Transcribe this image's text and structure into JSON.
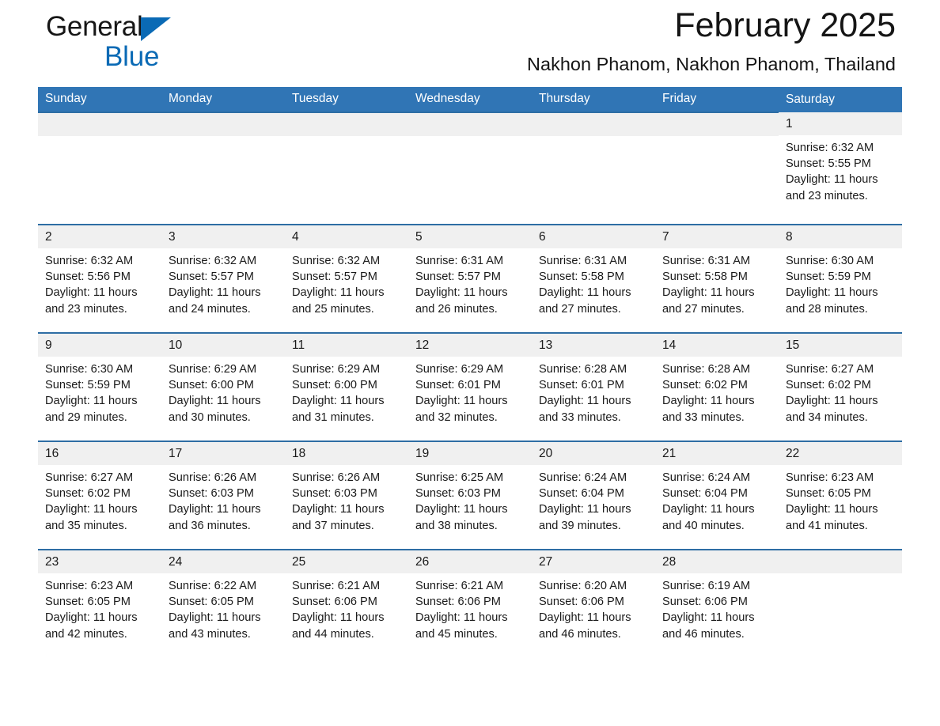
{
  "brand": {
    "name_part1": "General",
    "name_part2": "Blue",
    "triangle_icon": "triangle-icon",
    "accent_color": "#0a6ab5"
  },
  "header": {
    "title": "February 2025",
    "subtitle": "Nakhon Phanom, Nakhon Phanom, Thailand"
  },
  "theme": {
    "header_blue": "#3075b5",
    "row_border_blue": "#2e6da4",
    "daynum_bg": "#f0f0f0"
  },
  "calendar": {
    "weekday_headers": [
      "Sunday",
      "Monday",
      "Tuesday",
      "Wednesday",
      "Thursday",
      "Friday",
      "Saturday"
    ],
    "weeks": [
      [
        {
          "day": "",
          "lines": []
        },
        {
          "day": "",
          "lines": []
        },
        {
          "day": "",
          "lines": []
        },
        {
          "day": "",
          "lines": []
        },
        {
          "day": "",
          "lines": []
        },
        {
          "day": "",
          "lines": []
        },
        {
          "day": "1",
          "lines": [
            "Sunrise: 6:32 AM",
            "Sunset: 5:55 PM",
            "Daylight: 11 hours",
            "and 23 minutes."
          ]
        }
      ],
      [
        {
          "day": "2",
          "lines": [
            "Sunrise: 6:32 AM",
            "Sunset: 5:56 PM",
            "Daylight: 11 hours",
            "and 23 minutes."
          ]
        },
        {
          "day": "3",
          "lines": [
            "Sunrise: 6:32 AM",
            "Sunset: 5:57 PM",
            "Daylight: 11 hours",
            "and 24 minutes."
          ]
        },
        {
          "day": "4",
          "lines": [
            "Sunrise: 6:32 AM",
            "Sunset: 5:57 PM",
            "Daylight: 11 hours",
            "and 25 minutes."
          ]
        },
        {
          "day": "5",
          "lines": [
            "Sunrise: 6:31 AM",
            "Sunset: 5:57 PM",
            "Daylight: 11 hours",
            "and 26 minutes."
          ]
        },
        {
          "day": "6",
          "lines": [
            "Sunrise: 6:31 AM",
            "Sunset: 5:58 PM",
            "Daylight: 11 hours",
            "and 27 minutes."
          ]
        },
        {
          "day": "7",
          "lines": [
            "Sunrise: 6:31 AM",
            "Sunset: 5:58 PM",
            "Daylight: 11 hours",
            "and 27 minutes."
          ]
        },
        {
          "day": "8",
          "lines": [
            "Sunrise: 6:30 AM",
            "Sunset: 5:59 PM",
            "Daylight: 11 hours",
            "and 28 minutes."
          ]
        }
      ],
      [
        {
          "day": "9",
          "lines": [
            "Sunrise: 6:30 AM",
            "Sunset: 5:59 PM",
            "Daylight: 11 hours",
            "and 29 minutes."
          ]
        },
        {
          "day": "10",
          "lines": [
            "Sunrise: 6:29 AM",
            "Sunset: 6:00 PM",
            "Daylight: 11 hours",
            "and 30 minutes."
          ]
        },
        {
          "day": "11",
          "lines": [
            "Sunrise: 6:29 AM",
            "Sunset: 6:00 PM",
            "Daylight: 11 hours",
            "and 31 minutes."
          ]
        },
        {
          "day": "12",
          "lines": [
            "Sunrise: 6:29 AM",
            "Sunset: 6:01 PM",
            "Daylight: 11 hours",
            "and 32 minutes."
          ]
        },
        {
          "day": "13",
          "lines": [
            "Sunrise: 6:28 AM",
            "Sunset: 6:01 PM",
            "Daylight: 11 hours",
            "and 33 minutes."
          ]
        },
        {
          "day": "14",
          "lines": [
            "Sunrise: 6:28 AM",
            "Sunset: 6:02 PM",
            "Daylight: 11 hours",
            "and 33 minutes."
          ]
        },
        {
          "day": "15",
          "lines": [
            "Sunrise: 6:27 AM",
            "Sunset: 6:02 PM",
            "Daylight: 11 hours",
            "and 34 minutes."
          ]
        }
      ],
      [
        {
          "day": "16",
          "lines": [
            "Sunrise: 6:27 AM",
            "Sunset: 6:02 PM",
            "Daylight: 11 hours",
            "and 35 minutes."
          ]
        },
        {
          "day": "17",
          "lines": [
            "Sunrise: 6:26 AM",
            "Sunset: 6:03 PM",
            "Daylight: 11 hours",
            "and 36 minutes."
          ]
        },
        {
          "day": "18",
          "lines": [
            "Sunrise: 6:26 AM",
            "Sunset: 6:03 PM",
            "Daylight: 11 hours",
            "and 37 minutes."
          ]
        },
        {
          "day": "19",
          "lines": [
            "Sunrise: 6:25 AM",
            "Sunset: 6:03 PM",
            "Daylight: 11 hours",
            "and 38 minutes."
          ]
        },
        {
          "day": "20",
          "lines": [
            "Sunrise: 6:24 AM",
            "Sunset: 6:04 PM",
            "Daylight: 11 hours",
            "and 39 minutes."
          ]
        },
        {
          "day": "21",
          "lines": [
            "Sunrise: 6:24 AM",
            "Sunset: 6:04 PM",
            "Daylight: 11 hours",
            "and 40 minutes."
          ]
        },
        {
          "day": "22",
          "lines": [
            "Sunrise: 6:23 AM",
            "Sunset: 6:05 PM",
            "Daylight: 11 hours",
            "and 41 minutes."
          ]
        }
      ],
      [
        {
          "day": "23",
          "lines": [
            "Sunrise: 6:23 AM",
            "Sunset: 6:05 PM",
            "Daylight: 11 hours",
            "and 42 minutes."
          ]
        },
        {
          "day": "24",
          "lines": [
            "Sunrise: 6:22 AM",
            "Sunset: 6:05 PM",
            "Daylight: 11 hours",
            "and 43 minutes."
          ]
        },
        {
          "day": "25",
          "lines": [
            "Sunrise: 6:21 AM",
            "Sunset: 6:06 PM",
            "Daylight: 11 hours",
            "and 44 minutes."
          ]
        },
        {
          "day": "26",
          "lines": [
            "Sunrise: 6:21 AM",
            "Sunset: 6:06 PM",
            "Daylight: 11 hours",
            "and 45 minutes."
          ]
        },
        {
          "day": "27",
          "lines": [
            "Sunrise: 6:20 AM",
            "Sunset: 6:06 PM",
            "Daylight: 11 hours",
            "and 46 minutes."
          ]
        },
        {
          "day": "28",
          "lines": [
            "Sunrise: 6:19 AM",
            "Sunset: 6:06 PM",
            "Daylight: 11 hours",
            "and 46 minutes."
          ]
        },
        {
          "day": "",
          "lines": []
        }
      ]
    ]
  }
}
